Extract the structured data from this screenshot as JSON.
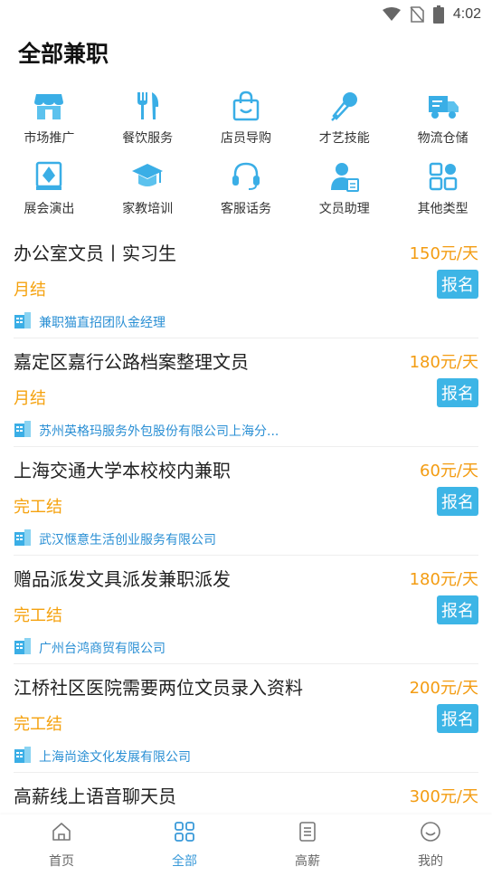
{
  "status": {
    "time": "4:02"
  },
  "page_title": "全部兼职",
  "categories": [
    {
      "label": "市场推广",
      "icon": "shop-icon"
    },
    {
      "label": "餐饮服务",
      "icon": "fork-knife-icon"
    },
    {
      "label": "店员导购",
      "icon": "shopping-bag-icon"
    },
    {
      "label": "才艺技能",
      "icon": "microphone-icon"
    },
    {
      "label": "物流仓储",
      "icon": "truck-icon"
    },
    {
      "label": "展会演出",
      "icon": "pen-nib-icon"
    },
    {
      "label": "家教培训",
      "icon": "graduation-cap-icon"
    },
    {
      "label": "客服话务",
      "icon": "headset-icon"
    },
    {
      "label": "文员助理",
      "icon": "clerk-icon"
    },
    {
      "label": "其他类型",
      "icon": "grid-icon"
    }
  ],
  "signup_label": "报名",
  "jobs": [
    {
      "title": "办公室文员丨实习生",
      "salary": "150元/天",
      "settle": "月结",
      "company": "兼职猫直招团队金经理"
    },
    {
      "title": "嘉定区嘉行公路档案整理文员",
      "salary": "180元/天",
      "settle": "月结",
      "company": "苏州英格玛服务外包股份有限公司上海分..."
    },
    {
      "title": "上海交通大学本校校内兼职",
      "salary": "60元/天",
      "settle": "完工结",
      "company": "武汉惬意生活创业服务有限公司"
    },
    {
      "title": "赠品派发文具派发兼职派发",
      "salary": "180元/天",
      "settle": "完工结",
      "company": "广州台鸿商贸有限公司"
    },
    {
      "title": "江桥社区医院需要两位文员录入资料",
      "salary": "200元/天",
      "settle": "完工结",
      "company": "上海尚途文化发展有限公司"
    },
    {
      "title": "高薪线上语音聊天员",
      "salary": "300元/天",
      "settle": "",
      "company": ""
    }
  ],
  "tabs": [
    {
      "label": "首页",
      "icon": "home-icon"
    },
    {
      "label": "全部",
      "icon": "grid-icon"
    },
    {
      "label": "高薪",
      "icon": "list-icon"
    },
    {
      "label": "我的",
      "icon": "smile-icon"
    }
  ],
  "colors": {
    "accent_blue": "#3db5e6",
    "salary_orange": "#f39c12",
    "company_blue": "#2a8fd4",
    "active_tab": "#3a9ad9"
  }
}
